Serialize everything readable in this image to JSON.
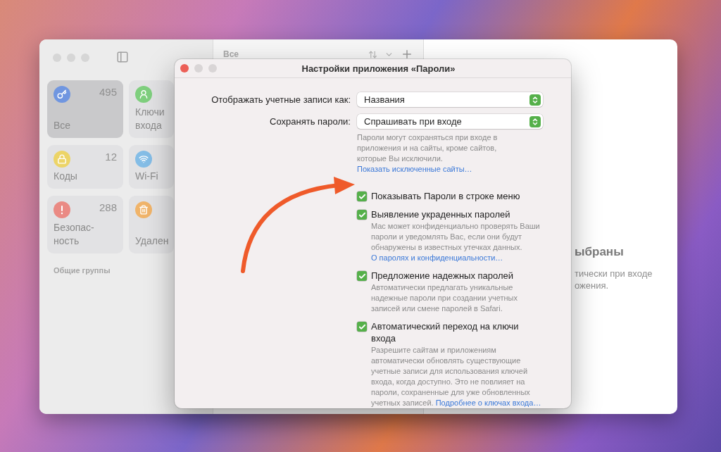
{
  "background_window": {
    "sidebar": {
      "tiles": [
        {
          "kind": "key",
          "label": "Все",
          "count": "495",
          "selected": true,
          "color": "#7096e0"
        },
        {
          "kind": "person",
          "label": "Ключи входа",
          "selected": false,
          "color": "#7fcf7e"
        },
        {
          "kind": "lock",
          "label": "Коды",
          "count": "12",
          "selected": false,
          "color": "#ecd467"
        },
        {
          "kind": "wifi",
          "label": "Wi-Fi",
          "selected": false,
          "color": "#84bde6"
        },
        {
          "kind": "alert",
          "label": "Безопас-\nность",
          "count": "288",
          "selected": false,
          "color": "#ea8a84"
        },
        {
          "kind": "trash",
          "label": "Удален",
          "selected": false,
          "color": "#f0b46a"
        }
      ],
      "section_label": "Общие группы"
    },
    "list": {
      "title": "Все"
    },
    "detail": {
      "heading": "ыбраны",
      "lines": [
        "тически при входе",
        "ожения."
      ]
    }
  },
  "dialog": {
    "title": "Настройки приложения «Пароли»",
    "rows": [
      {
        "label": "Отображать учетные записи как:",
        "value": "Названия"
      },
      {
        "label": "Сохранять пароли:",
        "value": "Спрашивать при входе"
      }
    ],
    "help": {
      "text": "Пароли могут сохраняться при входе в приложения и на сайты, кроме сайтов, которые Вы исключили.",
      "link": "Показать исключенные сайты…"
    },
    "options": [
      {
        "label": "Показывать Пароли в строке меню",
        "checked": true
      },
      {
        "label": "Выявление украденных паролей",
        "checked": true,
        "description": "Mac может конфиденциально проверять Ваши пароли и уведомлять Вас, если они будут обнаружены в известных утечках данных.",
        "link": "О паролях и конфиденциальности…"
      },
      {
        "label": "Предложение надежных паролей",
        "checked": true,
        "description": "Автоматически предлагать уникальные надежные пароли при создании учетных записей или смене паролей в Safari."
      },
      {
        "label": "Автоматический переход на ключи входа",
        "checked": true,
        "description": "Разрешите сайтам и приложениям автоматически обновлять существующие учетные записи для использования ключей входа, когда доступно. Это не повлияет на пароли, сохраненные для уже обновленных учетных записей.",
        "link": "Подробнее о ключах входа…"
      }
    ]
  }
}
